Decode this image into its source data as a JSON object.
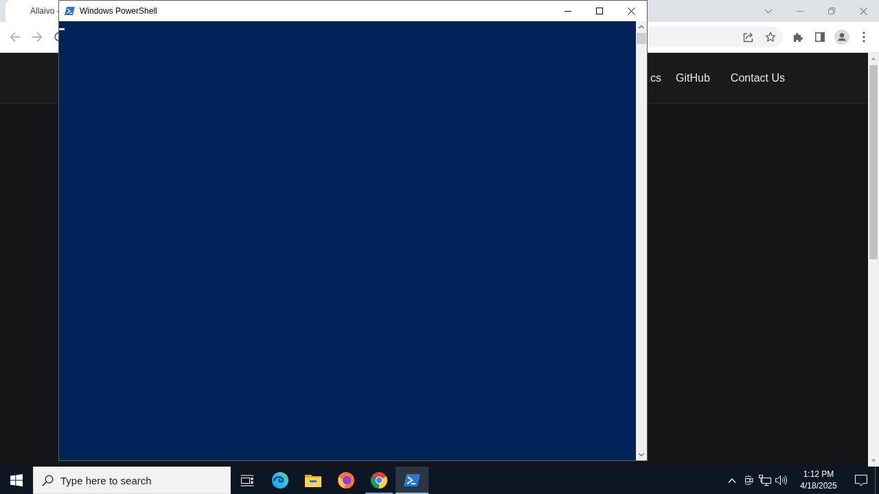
{
  "browser": {
    "tab": {
      "title": "Allaivo -"
    },
    "nav_links": [
      "cs",
      "GitHub",
      "Contact Us"
    ]
  },
  "powershell": {
    "title": "Windows PowerShell"
  },
  "taskbar": {
    "search": {
      "placeholder": "Type here to search"
    },
    "apps": [
      {
        "kind": "edge",
        "running": false,
        "selected": false
      },
      {
        "kind": "explorer",
        "running": false,
        "selected": false
      },
      {
        "kind": "firefox",
        "running": false,
        "selected": false
      },
      {
        "kind": "chrome",
        "running": true,
        "selected": false
      },
      {
        "kind": "powershell",
        "running": true,
        "selected": true
      }
    ],
    "clock": {
      "time": "1:12 PM",
      "date": "4/18/2025"
    }
  }
}
